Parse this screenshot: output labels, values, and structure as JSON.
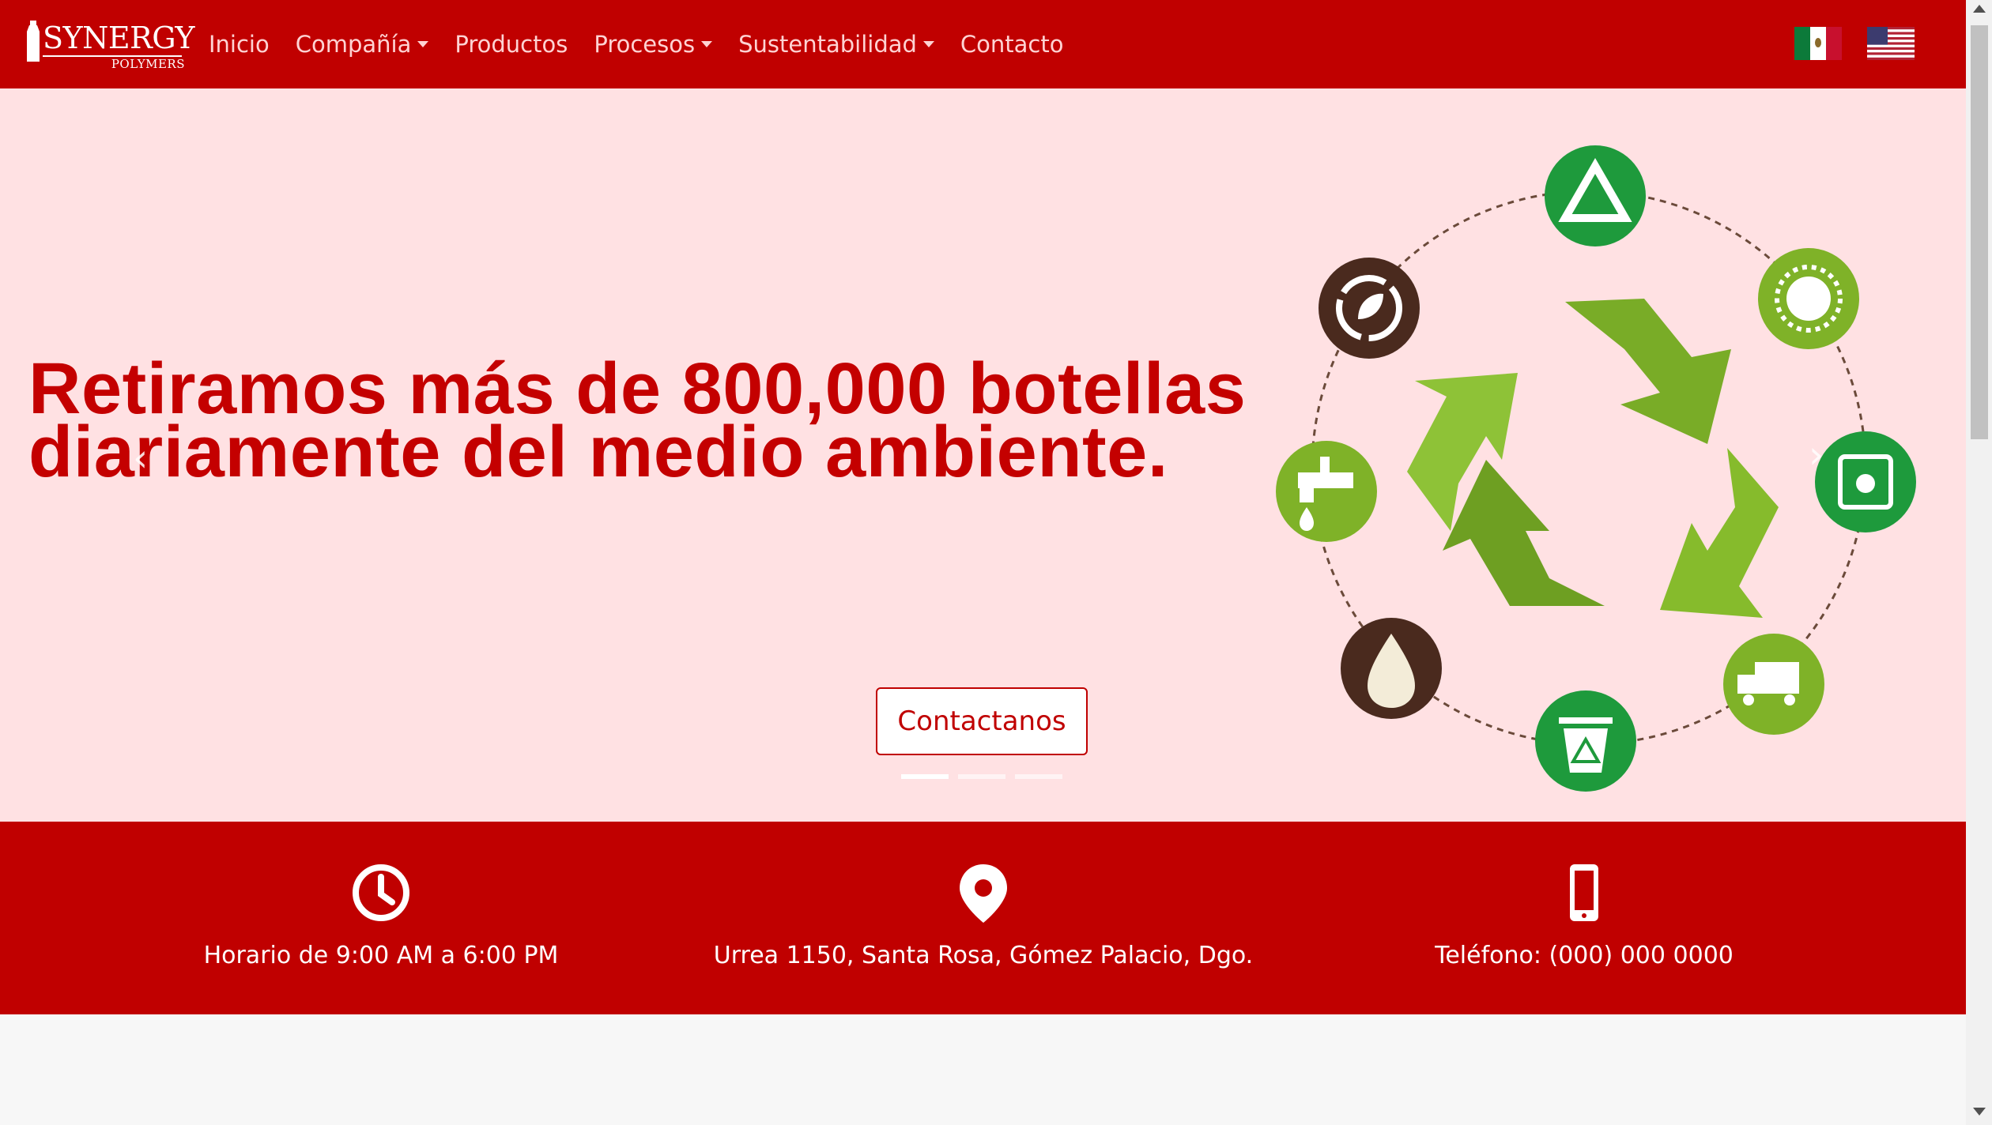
{
  "brand": {
    "name": "SYNERGY",
    "sub": "POLYMERS"
  },
  "nav": {
    "items": [
      {
        "label": "Inicio",
        "dropdown": false
      },
      {
        "label": "Compañía",
        "dropdown": true
      },
      {
        "label": "Productos",
        "dropdown": false
      },
      {
        "label": "Procesos",
        "dropdown": true
      },
      {
        "label": "Sustentabilidad",
        "dropdown": true
      },
      {
        "label": "Contacto",
        "dropdown": false
      }
    ],
    "languages": [
      {
        "name": "mexico-flag"
      },
      {
        "name": "usa-flag"
      }
    ]
  },
  "hero": {
    "headline_line1": "Retiramos más de 800,000 botellas",
    "headline_line2": "diariamente del medio ambiente.",
    "cta_label": "Contactanos",
    "slides": 3,
    "active_slide": 1,
    "prev_glyph": "‹",
    "next_glyph": "›"
  },
  "info": {
    "hours": "Horario de 9:00 AM a 6:00 PM",
    "address": "Urrea 1150, Santa Rosa, Gómez Palacio, Dgo.",
    "phone": "Teléfono: (000) 000 0000"
  },
  "colors": {
    "primary": "#c00000",
    "hero_bg": "#ffe1e3",
    "headline": "#c40000",
    "green": "#1e9a3c",
    "lime": "#7fb228",
    "brown": "#4a2a1e"
  },
  "icons": [
    "recycle-icon",
    "sun-icon",
    "fuel-can-icon",
    "truck-icon",
    "trash-bin-icon",
    "water-drop-icon",
    "water-tap-icon",
    "leaf-cycle-icon",
    "clock-icon",
    "location-pin-icon",
    "phone-icon"
  ]
}
